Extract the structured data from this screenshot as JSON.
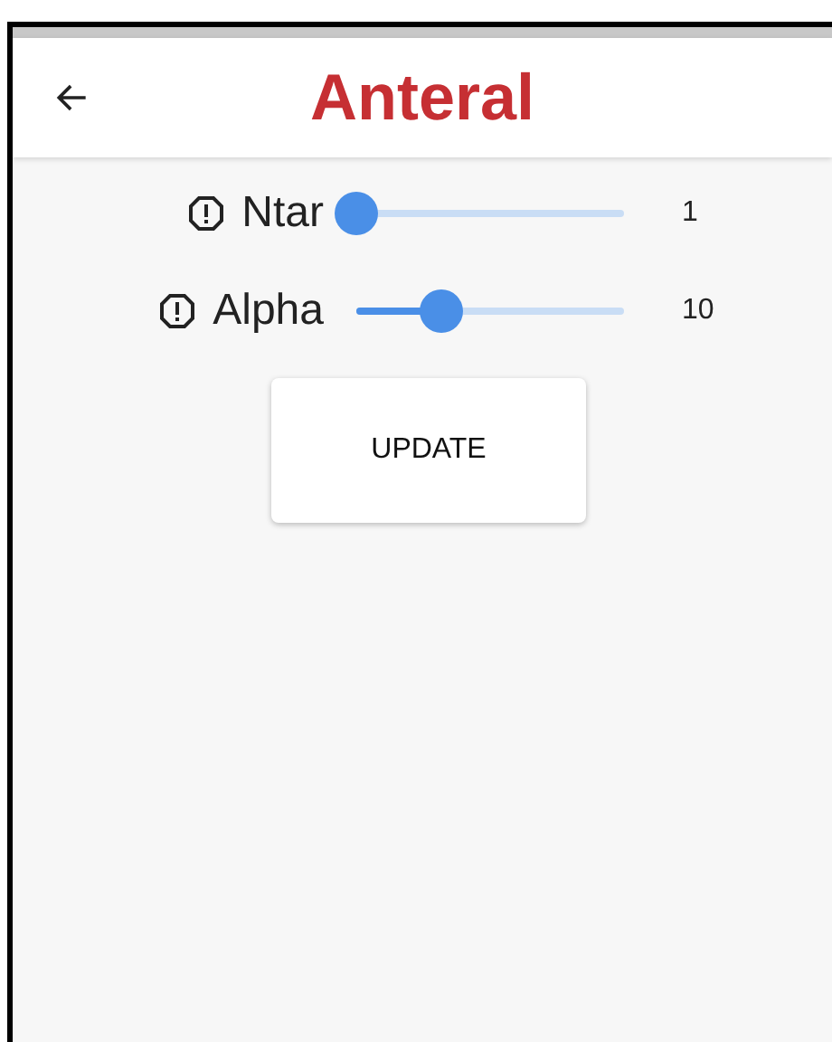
{
  "app_bar": {
    "title": "Anteral"
  },
  "sliders": [
    {
      "label": "Ntar",
      "level": 0,
      "reading": "1"
    },
    {
      "label": "Alpha",
      "level": 0.32,
      "reading": "10"
    }
  ],
  "button": {
    "label": "UPDATE"
  }
}
